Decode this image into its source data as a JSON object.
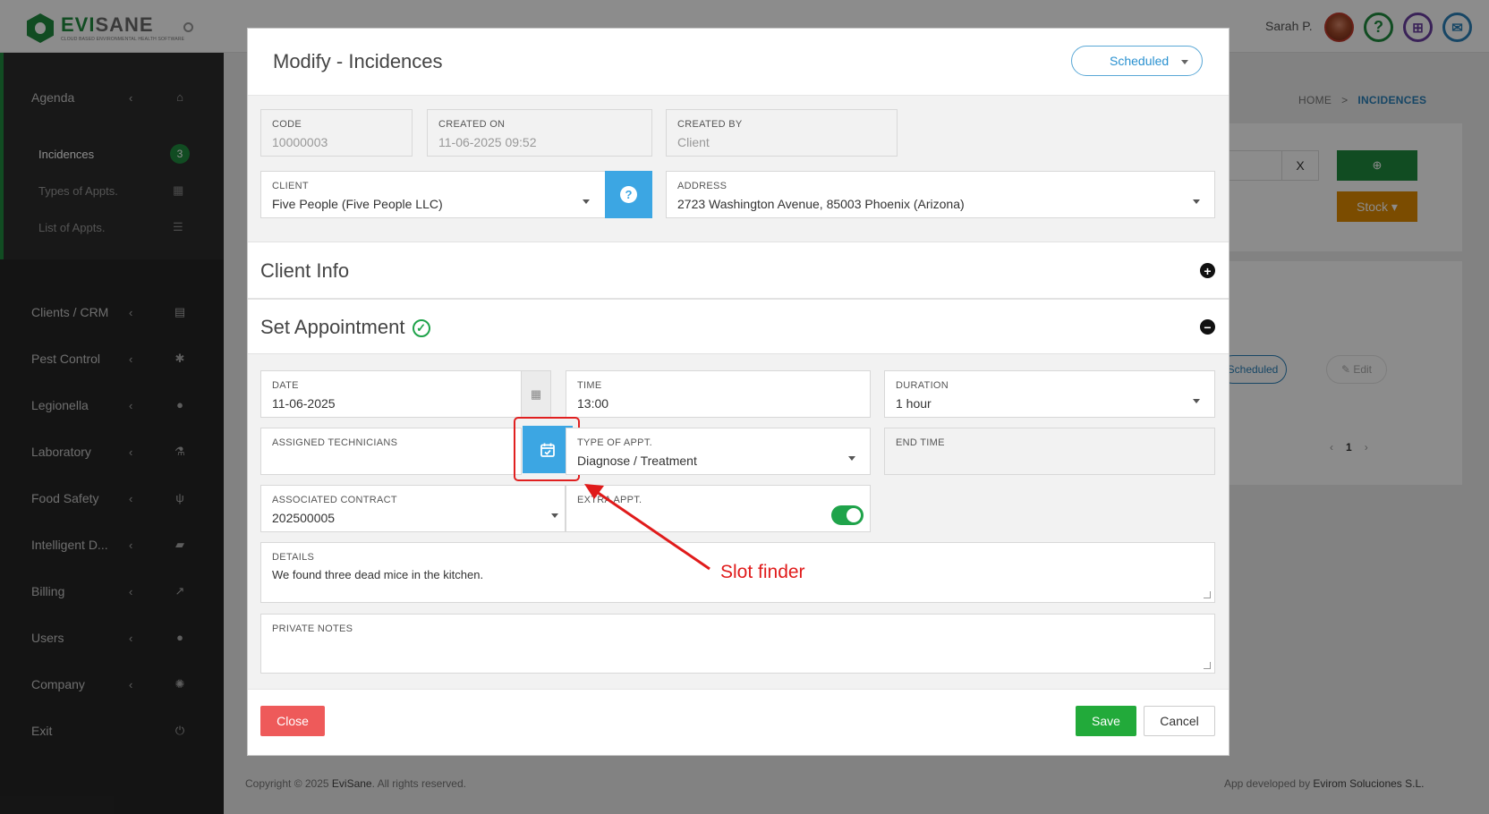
{
  "app": {
    "brand_main": "EVI",
    "brand_accent": "SANE",
    "brand_tagline": "CLOUD BASED ENVIRONMENTAL HEALTH SOFTWARE",
    "user_name": "Sarah P."
  },
  "sidebar": {
    "agenda": {
      "label": "Agenda",
      "chevron": "‹",
      "icon": "home-icon"
    },
    "agenda_sub": [
      {
        "label": "Incidences",
        "badge": "3",
        "active": true
      },
      {
        "label": "Types of Appts.",
        "icon": "calendar-icon"
      },
      {
        "label": "List of Appts.",
        "icon": "list-icon"
      }
    ],
    "items": [
      {
        "label": "Clients / CRM",
        "chevron": "‹",
        "icon": "id-card-icon",
        "glyph": "▤"
      },
      {
        "label": "Pest Control",
        "chevron": "‹",
        "icon": "bug-icon",
        "glyph": "✱"
      },
      {
        "label": "Legionella",
        "chevron": "‹",
        "icon": "drop-icon",
        "glyph": "●"
      },
      {
        "label": "Laboratory",
        "chevron": "‹",
        "icon": "flask-icon",
        "glyph": "⚗"
      },
      {
        "label": "Food Safety",
        "chevron": "‹",
        "icon": "cutlery-icon",
        "glyph": "ψ"
      },
      {
        "label": "Intelligent D...",
        "chevron": "‹",
        "icon": "folder-open-icon",
        "glyph": "▰"
      },
      {
        "label": "Billing",
        "chevron": "‹",
        "icon": "line-chart-icon",
        "glyph": "↗"
      },
      {
        "label": "Users",
        "chevron": "‹",
        "icon": "user-icon",
        "glyph": "●"
      },
      {
        "label": "Company",
        "chevron": "‹",
        "icon": "gear-icon",
        "glyph": "✺"
      },
      {
        "label": "Exit",
        "chevron": "",
        "icon": "power-icon",
        "glyph": "⏻"
      }
    ]
  },
  "background": {
    "breadcrumb_home": "HOME",
    "breadcrumb_sep": ">",
    "breadcrumb_current": "INCIDENCES",
    "clear_button": "X",
    "stock_button": "Stock ▾",
    "row_status": "Scheduled",
    "row_edit": "✎ Edit",
    "pager_prev": "‹",
    "pager_page": "1",
    "pager_next": "›",
    "footer_left_pre": "Copyright © 2025 ",
    "footer_left_brand": "EviSane",
    "footer_left_post": ". All rights reserved.",
    "footer_right_pre": "App developed by ",
    "footer_right_brand": "Evirom Soluciones S.L."
  },
  "modal": {
    "title": "Modify - Incidences",
    "status": "Scheduled",
    "fields": {
      "code": {
        "label": "CODE",
        "value": "10000003"
      },
      "created_on": {
        "label": "CREATED ON",
        "value": "11-06-2025 09:52"
      },
      "created_by": {
        "label": "CREATED BY",
        "value": "Client"
      },
      "client": {
        "label": "CLIENT",
        "value": "Five People (Five People LLC)"
      },
      "address": {
        "label": "ADDRESS",
        "value": "2723 Washington Avenue, 85003 Phoenix (Arizona)"
      },
      "date": {
        "label": "DATE",
        "value": "11-06-2025"
      },
      "time": {
        "label": "TIME",
        "value": "13:00"
      },
      "duration": {
        "label": "DURATION",
        "value": "1 hour"
      },
      "technicians": {
        "label": "ASSIGNED TECHNICIANS",
        "value": ""
      },
      "type": {
        "label": "TYPE OF APPT.",
        "value": "Diagnose / Treatment"
      },
      "end_time": {
        "label": "END TIME",
        "value": ""
      },
      "contract": {
        "label": "ASSOCIATED CONTRACT",
        "value": "202500005"
      },
      "extra": {
        "label": "EXTRA APPT.",
        "on": true
      },
      "details": {
        "label": "DETAILS",
        "value": "We found three dead mice in the kitchen."
      },
      "private_notes": {
        "label": "PRIVATE NOTES",
        "value": ""
      }
    },
    "sections": {
      "client_info": "Client Info",
      "set_appointment": "Set Appointment"
    },
    "buttons": {
      "close": "Close",
      "save": "Save",
      "cancel": "Cancel"
    }
  },
  "annotation": {
    "text": "Slot finder",
    "color": "#e01b1b"
  },
  "colors": {
    "brand_green": "#1f8a3f",
    "accent_blue": "#3ca6e3",
    "save_green": "#22aa3a",
    "close_red": "#ee5a5a",
    "stock_orange": "#e08a00"
  }
}
